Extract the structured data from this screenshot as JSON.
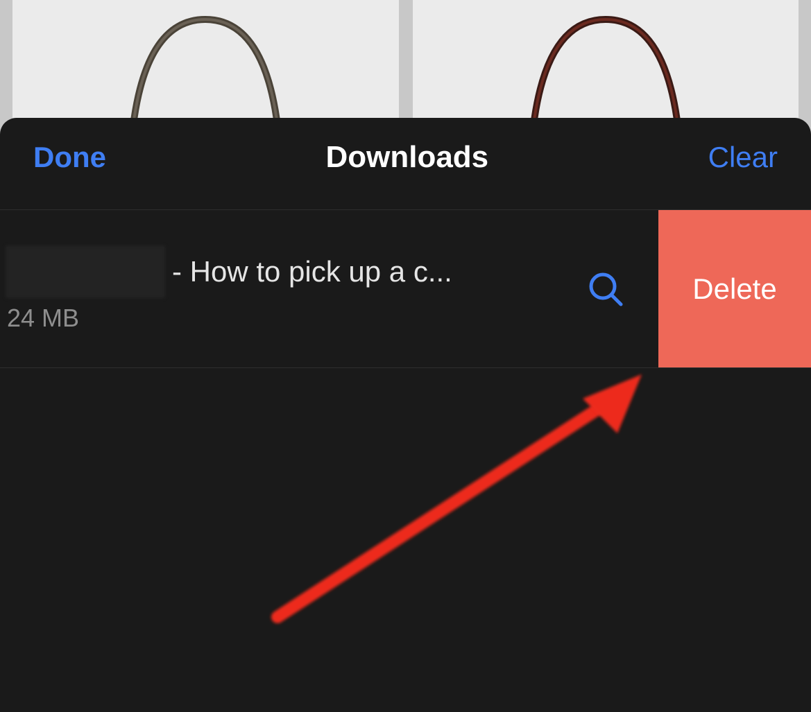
{
  "sheet": {
    "done_label": "Done",
    "title": "Downloads",
    "clear_label": "Clear"
  },
  "downloads": [
    {
      "title_suffix": "- How to pick up a c...",
      "size": "24 MB",
      "delete_label": "Delete"
    }
  ],
  "colors": {
    "accent": "#3f7ef3",
    "delete_bg": "#ee6858",
    "sheet_bg": "#1a1a1a"
  }
}
